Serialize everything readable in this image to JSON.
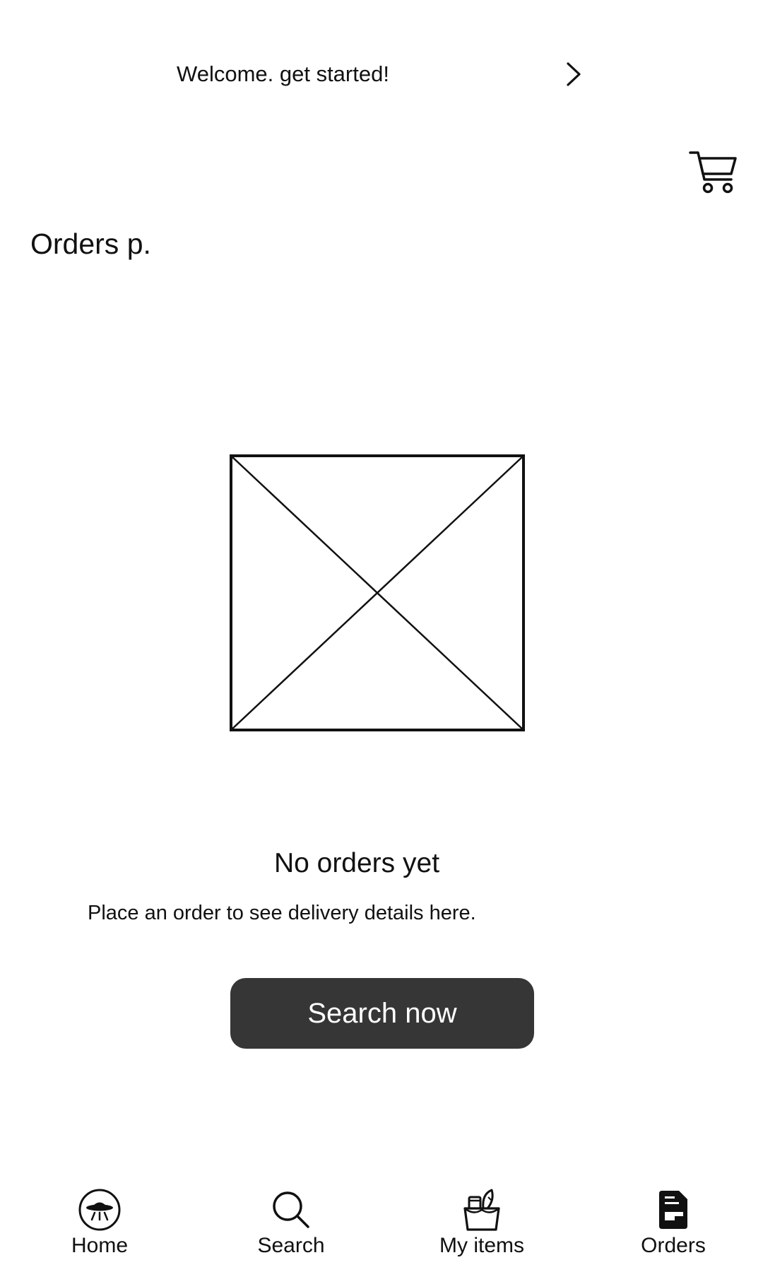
{
  "banner": {
    "text": "Welcome. get started!",
    "icon": "chevron-right-icon"
  },
  "header": {
    "cart_icon": "cart-icon",
    "title": "Orders p."
  },
  "empty_state": {
    "image_icon": "image-placeholder-icon",
    "title": "No orders yet",
    "subtitle": "Place an order to see delivery details here.",
    "button_label": "Search now"
  },
  "bottom_nav": {
    "items": [
      {
        "label": "Home",
        "icon": "ufo-icon"
      },
      {
        "label": "Search",
        "icon": "search-icon"
      },
      {
        "label": "My items",
        "icon": "grocery-bag-icon"
      },
      {
        "label": "Orders",
        "icon": "document-icon",
        "active": true
      }
    ]
  },
  "colors": {
    "button_background": "#363636",
    "button_text": "#ffffff",
    "text": "#111111",
    "background": "#ffffff"
  }
}
